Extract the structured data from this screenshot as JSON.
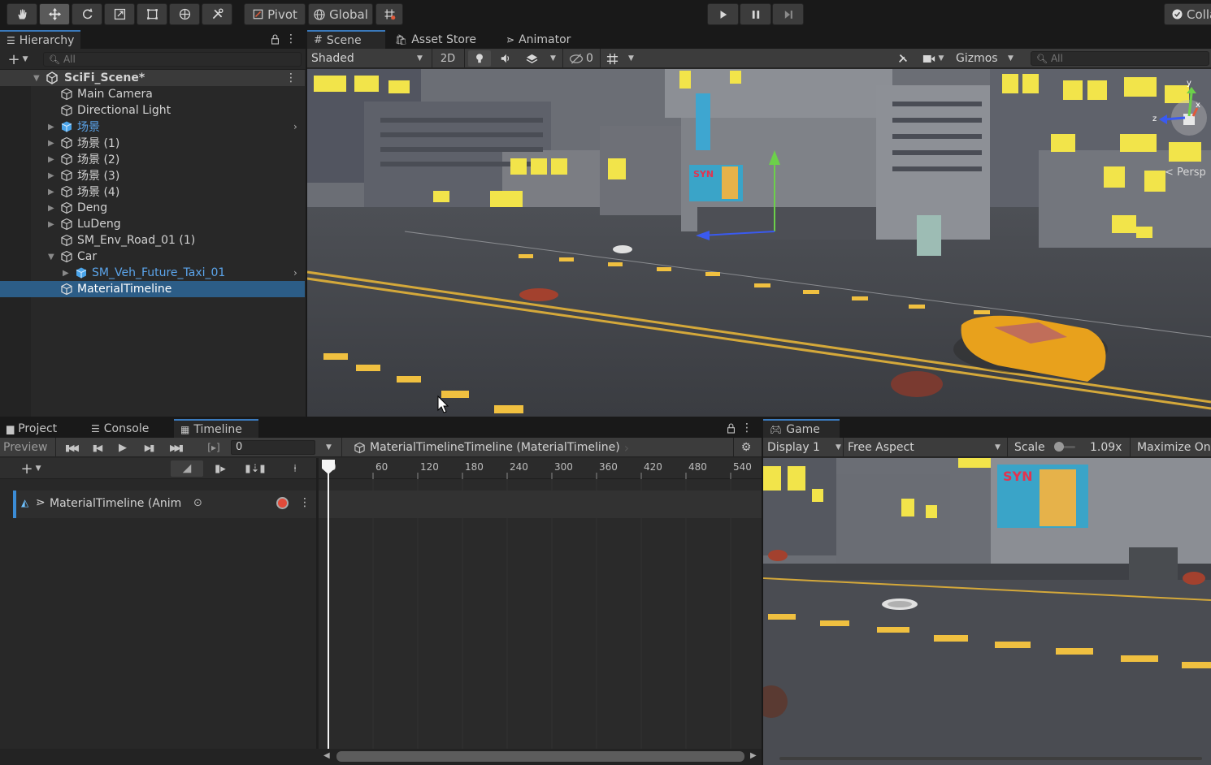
{
  "toolbar": {
    "pivot_label": "Pivot",
    "global_label": "Global",
    "collab_label": "Colla"
  },
  "hierarchy": {
    "tab_label": "Hierarchy",
    "search_placeholder": "All",
    "scene_name": "SciFi_Scene*",
    "items": [
      {
        "label": "Main Camera",
        "blue": false
      },
      {
        "label": "Directional Light",
        "blue": false
      },
      {
        "label": "场景",
        "blue": true
      },
      {
        "label": "场景 (1)",
        "blue": false
      },
      {
        "label": "场景 (2)",
        "blue": false
      },
      {
        "label": "场景 (3)",
        "blue": false
      },
      {
        "label": "场景 (4)",
        "blue": false
      },
      {
        "label": "Deng",
        "blue": false
      },
      {
        "label": "LuDeng",
        "blue": false
      },
      {
        "label": "SM_Env_Road_01 (1)",
        "blue": false
      },
      {
        "label": "Car",
        "blue": false
      },
      {
        "label": "SM_Veh_Future_Taxi_01",
        "blue": true
      },
      {
        "label": "MaterialTimeline",
        "blue": false,
        "selected": true
      }
    ]
  },
  "scene": {
    "tabs": [
      "Scene",
      "Asset Store",
      "Animator"
    ],
    "shading_mode": "Shaded",
    "mode_2d": "2D",
    "hidden_count": "0",
    "gizmos_label": "Gizmos",
    "search_placeholder": "All",
    "persp_label": "< Persp",
    "axis_x": "x",
    "axis_y": "y",
    "axis_z": "z",
    "billboard_text": "SYN"
  },
  "bottom": {
    "tabs": [
      "Project",
      "Console",
      "Timeline"
    ]
  },
  "timeline": {
    "preview_label": "Preview",
    "frame_value": "0",
    "asset_label": "MaterialTimelineTimeline (MaterialTimeline)",
    "track_label": "MaterialTimeline (Anim",
    "ruler": [
      "0",
      "60",
      "120",
      "180",
      "240",
      "300",
      "360",
      "420",
      "480",
      "540"
    ]
  },
  "game": {
    "tab_label": "Game",
    "display": "Display 1",
    "aspect": "Free Aspect",
    "scale_label": "Scale",
    "scale_value": "1.09x",
    "maximize_label": "Maximize On",
    "billboard_text": "SYN"
  },
  "colors": {
    "accent": "#3a79bb",
    "selection": "#2c5d87",
    "taxi": "#e8a11c",
    "window_yellow": "#f2e44a"
  }
}
